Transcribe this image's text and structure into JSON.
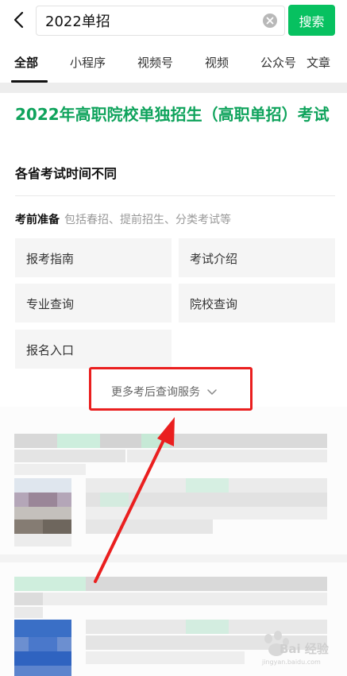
{
  "search": {
    "query": "2022单招",
    "button_label": "搜索"
  },
  "tabs": [
    "全部",
    "小程序",
    "视频号",
    "视频",
    "公众号",
    "文章"
  ],
  "result": {
    "title": "2022年高职院校单独招生（高职单招）考试",
    "subtitle": "各省考试时间不同",
    "section": {
      "title": "考前准备",
      "desc": "包括春招、提前招生、分类考试等"
    },
    "buttons": [
      "报考指南",
      "考试介绍",
      "专业查询",
      "院校查询",
      "报名入口"
    ],
    "more_label": "更多考后查询服务"
  },
  "watermark": {
    "text": "Bai 经验",
    "url": "jingyan.baidu.com"
  },
  "colors": {
    "brand_green": "#07c160",
    "title_green": "#0fa35c",
    "annotation_red": "#ea1f1f"
  }
}
